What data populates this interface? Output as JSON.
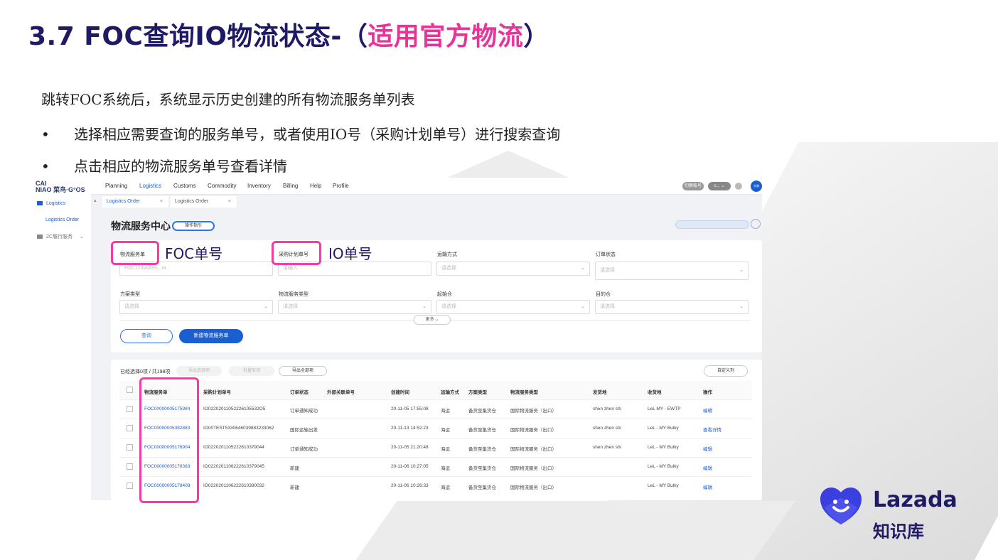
{
  "slide": {
    "title_main": "3.7  FOC查询IO物流状态-（",
    "title_accent": "适用官方物流",
    "title_end": "）",
    "intro": "跳转FOC系统后，系统显示历史创建的所有物流服务单列表",
    "bullets": [
      "选择相应需要查询的服务单号，或者使用IO号（采购计划单号）进行搜索查询",
      "点击相应的物流服务单号查看详情"
    ],
    "bullet_symbol": "•",
    "annotations": {
      "foc": "FOC单号",
      "io": "IO单号"
    }
  },
  "app": {
    "logo_top": "CAI",
    "logo_bottom": "NIAO 菜鸟·G°OS",
    "nav": [
      "Planning",
      "Logistics",
      "Customs",
      "Commodity",
      "Inventory",
      "Billing",
      "Help",
      "Profile"
    ],
    "nav_active": "Logistics",
    "top_right": {
      "switch_btn": "切换账号",
      "user_btn": "c...  ⌄",
      "avatar": "头像"
    },
    "sidebar": {
      "group": "Logistics",
      "item": "Logistics Order",
      "group2": "2C履行服务"
    },
    "tabs": [
      {
        "label": "Logistics Order",
        "close": "×"
      },
      {
        "label": "Logistics Order",
        "close": "×"
      }
    ],
    "page_title": "物流服务中心",
    "guide_btn": "操作指引",
    "filters": {
      "row1": [
        {
          "label": "物流服务单",
          "placeholder": "FOC123|Adres...xx"
        },
        {
          "label": "采购计划单号",
          "placeholder": "请输入"
        },
        {
          "label": "运输方式",
          "placeholder": "请选择"
        },
        {
          "label": "订单状态",
          "placeholder": "请选择"
        }
      ],
      "row2": [
        {
          "label": "方案类型",
          "placeholder": "请选择"
        },
        {
          "label": "物流服务类型",
          "placeholder": "请选择"
        },
        {
          "label": "起始仓",
          "placeholder": "请选择"
        },
        {
          "label": "目的仓",
          "placeholder": "请选择"
        }
      ],
      "more": "更多 ⌄",
      "query_btn": "查询",
      "new_btn": "新建物流服务单"
    },
    "table": {
      "selection_info": "已经选择0项 / 共198项",
      "export_selected": "导出选择项",
      "batch_cancel": "批量取消",
      "export_all": "导出全部项",
      "custom_columns": "自定义列",
      "headers": [
        "物流服务单",
        "采购计划单号",
        "订单状态",
        "外部关联单号",
        "创建时间",
        "运输方式",
        "方案类型",
        "物流服务类型",
        "发货地",
        "收货地",
        "操作"
      ],
      "rows": [
        [
          "FOC00000005175984",
          "IO02202011052226105532O5",
          "订单通知成功",
          "",
          "20-11-05 17:55:08",
          "海运",
          "备货至集货仓",
          "国际物流服务（出口）",
          "shen zhen shi",
          "LeL MY - EWTP",
          "编辑"
        ],
        [
          "FOC00000005382883",
          "IO00TEST533064603988323306​2",
          "国际运输出发",
          "",
          "20-11-13 14:52:23",
          "海运",
          "备货至集货仓",
          "国际物流服务（出口）",
          "shen zhen shi",
          "LeL - MY Bulky",
          "查看详情"
        ],
        [
          "FOC00000005176904",
          "IO022020110522261037904​4",
          "订单通知成功",
          "",
          "20-11-05 21:20:48",
          "海运",
          "备货至集货仓",
          "国际物流服务（出口）",
          "shen zhen shi",
          "LeL - MY Bulky",
          "编辑"
        ],
        [
          "FOC00000005178383",
          "IO022020110622261037904​5",
          "新建",
          "",
          "20-11-06 10:27:05",
          "海运",
          "备货至集货仓",
          "国际物流服务（出口）",
          "",
          "LeL - MY Bulky",
          "编辑"
        ],
        [
          "FOC00000005178408",
          "IO022020110622261038003​2",
          "新建",
          "",
          "20-11-06 10:26:33",
          "海运",
          "备货至集货仓",
          "国际物流服务（出口）",
          "",
          "LeL - MY Bulky",
          "编辑"
        ]
      ]
    }
  },
  "brand": {
    "name": "Lazada",
    "sub": "知识库",
    "color": "#1f1a66",
    "mark_color": "#3b3fe0"
  },
  "colors": {
    "title": "#1f1a66",
    "accent": "#e8339a",
    "highlight": "#ee3fa6",
    "link": "#1a5fd0"
  }
}
